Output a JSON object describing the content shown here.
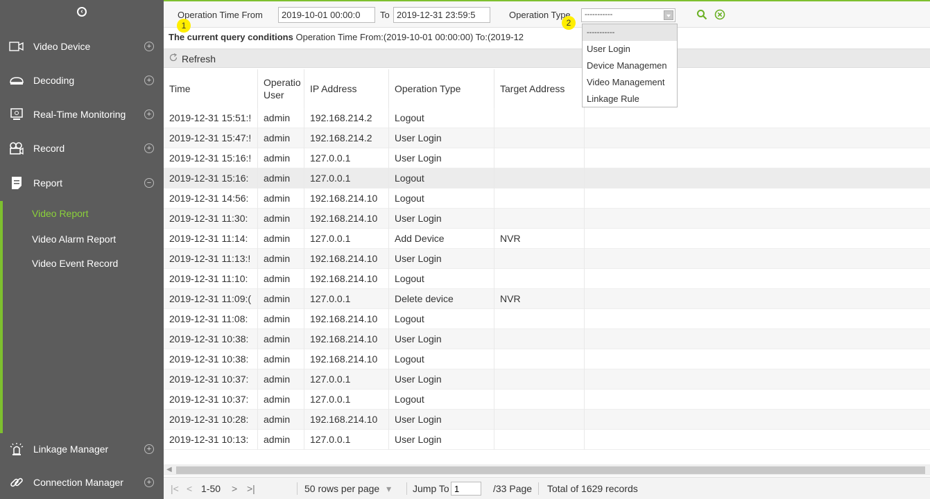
{
  "sidebar": {
    "collapse_glyph": "‹",
    "items": [
      {
        "label": "Video Device"
      },
      {
        "label": "Decoding"
      },
      {
        "label": "Real-Time Monitoring"
      },
      {
        "label": "Record"
      },
      {
        "label": "Report"
      },
      {
        "label": "Linkage Manager"
      },
      {
        "label": "Connection Manager"
      }
    ],
    "report_subitems": [
      {
        "label": "Video Report",
        "active": true
      },
      {
        "label": "Video Alarm Report"
      },
      {
        "label": "Video Event Record"
      }
    ],
    "accent_color": "#7ec02f"
  },
  "query": {
    "time_from_label": "Operation Time From",
    "time_from_value": "2019-10-01 00:00:0",
    "to_label": "To",
    "time_to_value": "2019-12-31 23:59:5",
    "operation_type_label": "Operation Type",
    "operation_type_value": "-----------",
    "search_icon": "search-icon",
    "clear_icon": "clear-icon"
  },
  "markers": [
    "1",
    "2"
  ],
  "conditions": {
    "bold": "The current query conditions",
    "text": "Operation Time From:(2019-10-01 00:00:00)  To:(2019-12"
  },
  "toolbar": {
    "refresh_label": "Refresh"
  },
  "dropdown": {
    "options": [
      "-----------",
      "User Login",
      "Device Managemen",
      "Video Management",
      "Linkage Rule"
    ]
  },
  "table": {
    "headers": [
      "Time",
      "Operatio\nUser",
      "IP Address",
      "Operation Type",
      "Target Address"
    ],
    "rows": [
      [
        "2019-12-31 15:51:!",
        "admin",
        "192.168.214.2",
        "Logout",
        ""
      ],
      [
        "2019-12-31 15:47:!",
        "admin",
        "192.168.214.2",
        "User Login",
        ""
      ],
      [
        "2019-12-31 15:16:!",
        "admin",
        "127.0.0.1",
        "User Login",
        ""
      ],
      [
        "2019-12-31 15:16:",
        "admin",
        "127.0.0.1",
        "Logout",
        ""
      ],
      [
        "2019-12-31 14:56:",
        "admin",
        "192.168.214.10",
        "Logout",
        ""
      ],
      [
        "2019-12-31 11:30:",
        "admin",
        "192.168.214.10",
        "User Login",
        ""
      ],
      [
        "2019-12-31 11:14:",
        "admin",
        "127.0.0.1",
        "Add Device",
        "NVR"
      ],
      [
        "2019-12-31 11:13:!",
        "admin",
        "192.168.214.10",
        "User Login",
        ""
      ],
      [
        "2019-12-31 11:10:",
        "admin",
        "192.168.214.10",
        "Logout",
        ""
      ],
      [
        "2019-12-31 11:09:(",
        "admin",
        "127.0.0.1",
        "Delete device",
        "NVR"
      ],
      [
        "2019-12-31 11:08:",
        "admin",
        "192.168.214.10",
        "Logout",
        ""
      ],
      [
        "2019-12-31 10:38:",
        "admin",
        "192.168.214.10",
        "User Login",
        ""
      ],
      [
        "2019-12-31 10:38:",
        "admin",
        "192.168.214.10",
        "Logout",
        ""
      ],
      [
        "2019-12-31 10:37:",
        "admin",
        "127.0.0.1",
        "User Login",
        ""
      ],
      [
        "2019-12-31 10:37:",
        "admin",
        "127.0.0.1",
        "Logout",
        ""
      ],
      [
        "2019-12-31 10:28:",
        "admin",
        "192.168.214.10",
        "User Login",
        ""
      ],
      [
        "2019-12-31 10:13:",
        "admin",
        "127.0.0.1",
        "User Login",
        ""
      ]
    ]
  },
  "pager": {
    "first": "|<",
    "prev": "<",
    "range": "1-50",
    "next": ">",
    "last": ">|",
    "rows_per_page": "50 rows per page",
    "rows_arrow": "▾",
    "jump_to_label": "Jump To",
    "jump_to_value": "1",
    "page_total": "/33 Page",
    "total_records": "Total of 1629 records"
  }
}
